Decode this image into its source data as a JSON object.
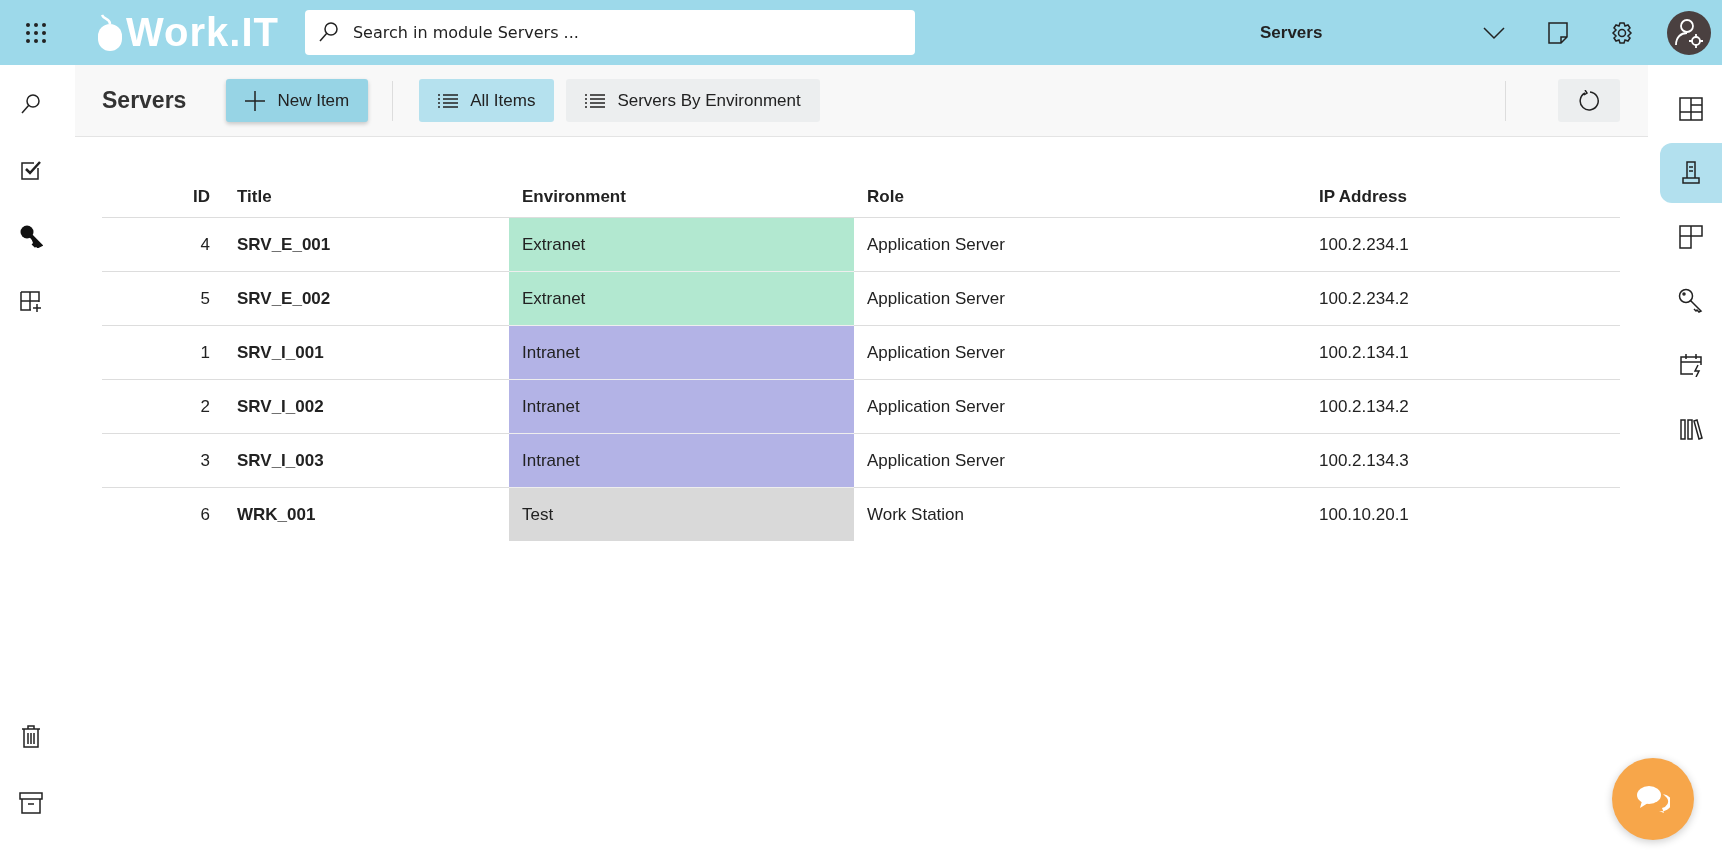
{
  "topbar": {
    "logo": "Work.IT",
    "search": {
      "placeholder": "Search in module Servers ..."
    },
    "module": "Servers"
  },
  "toolbar": {
    "title": "Servers",
    "new_item": "New Item",
    "views": [
      {
        "label": "All Items",
        "selected": true
      },
      {
        "label": "Servers By Environment",
        "selected": false
      }
    ]
  },
  "table": {
    "columns": [
      "ID",
      "Title",
      "Environment",
      "Role",
      "IP Address"
    ],
    "rows": [
      {
        "id": "4",
        "title": "SRV_E_001",
        "environment": "Extranet",
        "color": "#b2e8d0",
        "role": "Application Server",
        "ip": "100.2.234.1"
      },
      {
        "id": "5",
        "title": "SRV_E_002",
        "environment": "Extranet",
        "color": "#b2e8d0",
        "role": "Application Server",
        "ip": "100.2.234.2"
      },
      {
        "id": "1",
        "title": "SRV_I_001",
        "environment": "Intranet",
        "color": "#b3b3e6",
        "role": "Application Server",
        "ip": "100.2.134.1"
      },
      {
        "id": "2",
        "title": "SRV_I_002",
        "environment": "Intranet",
        "color": "#b3b3e6",
        "role": "Application Server",
        "ip": "100.2.134.2"
      },
      {
        "id": "3",
        "title": "SRV_I_003",
        "environment": "Intranet",
        "color": "#b3b3e6",
        "role": "Application Server",
        "ip": "100.2.134.3"
      },
      {
        "id": "6",
        "title": "WRK_001",
        "environment": "Test",
        "color": "#d9d9d9",
        "role": "Work Station",
        "ip": "100.10.20.1"
      }
    ]
  },
  "right_rail": [
    {
      "selected": false
    },
    {
      "selected": true
    },
    {
      "selected": false
    },
    {
      "selected": false
    },
    {
      "selected": false
    },
    {
      "selected": false
    }
  ]
}
